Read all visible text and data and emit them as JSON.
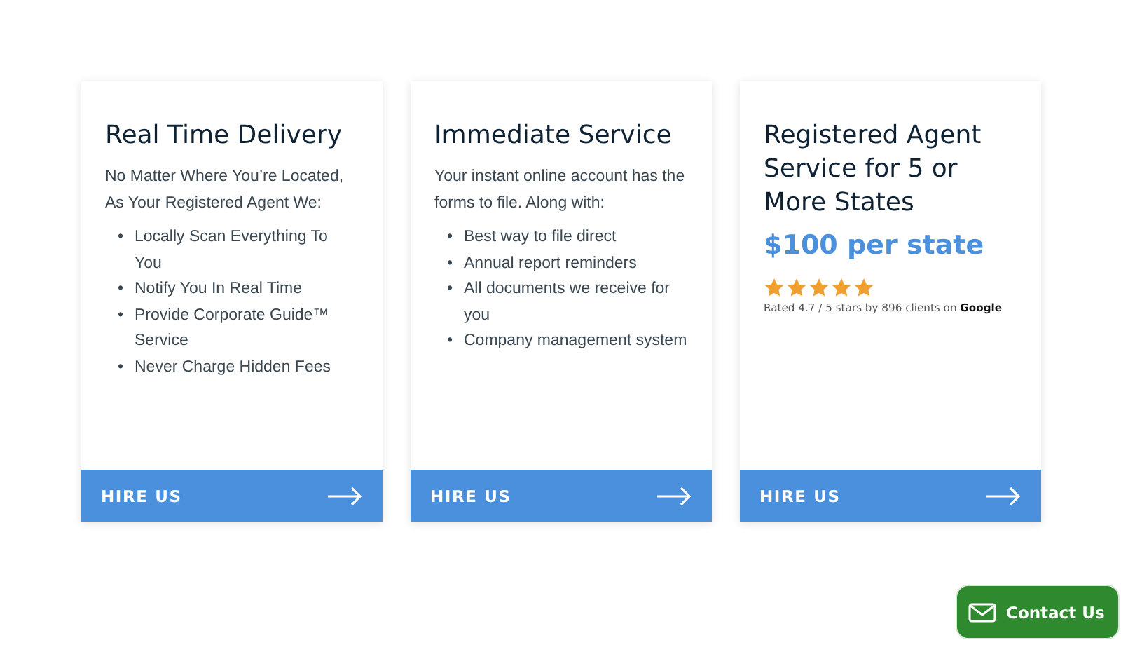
{
  "cards": [
    {
      "kind": "list",
      "title": "Real Time Delivery",
      "intro": "No Matter Where You’re Located, As Your Registered Agent We:",
      "items": [
        {
          "bullet": "•",
          "text": "Locally Scan Everything To You"
        },
        {
          "bullet": "•",
          "text": "Notify You In Real Time"
        },
        {
          "bullet": "•",
          "text": "Provide Corporate Guide™ Service"
        },
        {
          "bullet": "•",
          "text": "Never Charge Hidden Fees"
        }
      ],
      "button": "HIRE US"
    },
    {
      "kind": "list",
      "title": "Immediate Service",
      "intro": "Your instant online account has the forms to file. Along with:",
      "items": [
        {
          "bullet": "•",
          "text": "Best way to file direct"
        },
        {
          "bullet": "•",
          "text": "Annual report reminders"
        },
        {
          "bullet": "•",
          "text": "All documents we receive for you"
        },
        {
          "bullet": "•",
          "text": "Company management system"
        }
      ],
      "button": "HIRE US"
    },
    {
      "kind": "price",
      "title": "Registered Agent Service for 5 or More States",
      "price": "$100 per state",
      "stars": 5,
      "rating": "Rated 4.7 / 5 stars by 896 clients on **Google**",
      "button": "HIRE US"
    }
  ],
  "contact_button": "Contact Us"
}
